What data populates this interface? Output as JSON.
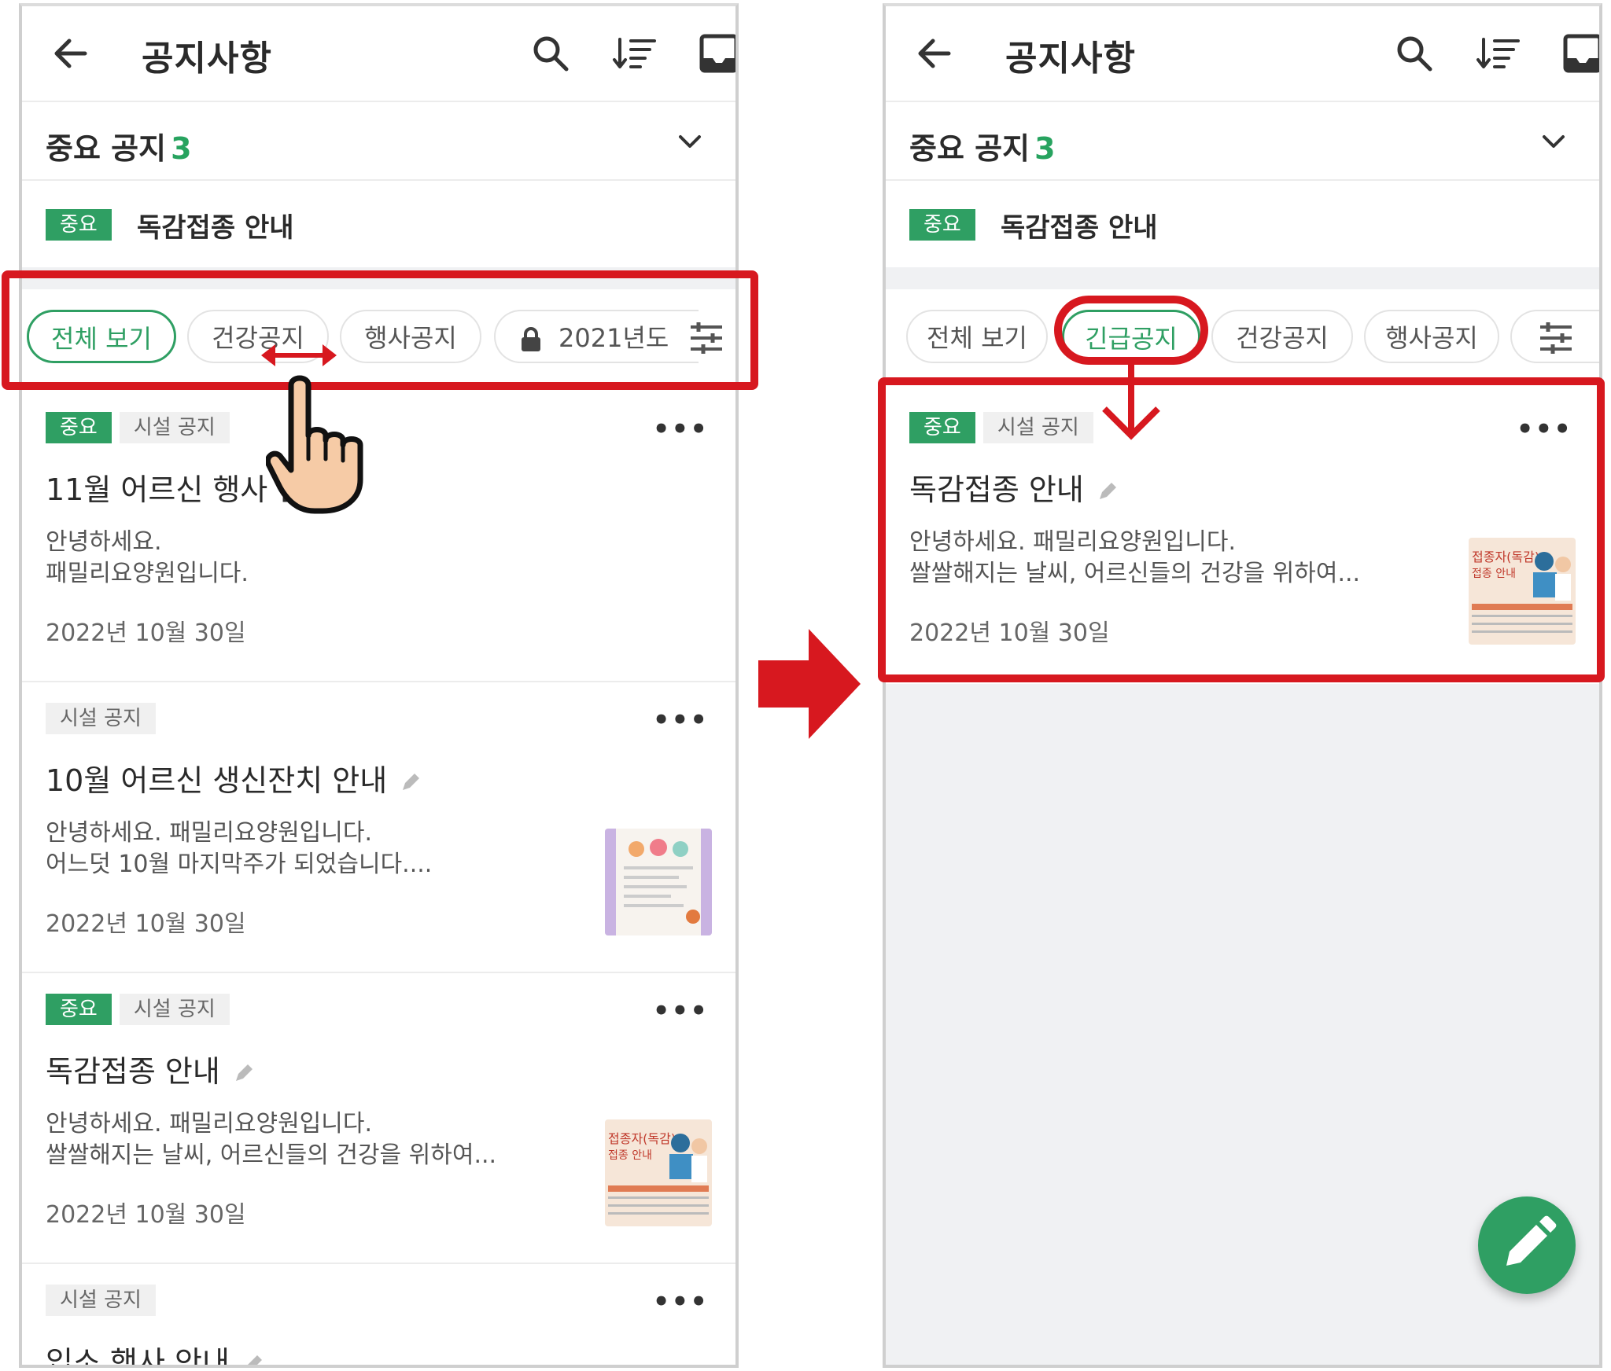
{
  "colors": {
    "accent_green": "#2f9f63",
    "highlight_red": "#d7181f",
    "badge_gray_bg": "#f0f0f0",
    "fill_gray": "#f0f1f3"
  },
  "left": {
    "appbar": {
      "title": "공지사항",
      "icons": [
        "back-arrow-icon",
        "search-icon",
        "sort-icon",
        "inbox-icon"
      ]
    },
    "important": {
      "label": "중요 공지",
      "count": "3",
      "item": {
        "badge": "중요",
        "title": "독감접종 안내"
      }
    },
    "chips": [
      "전체 보기",
      "건강공지",
      "행사공지",
      "2021년도"
    ],
    "posts": [
      {
        "badges": [
          "중요",
          "시설 공지"
        ],
        "title": "11월 어르신 행사 안내",
        "body1": "안녕하세요.",
        "body2": "패밀리요양원입니다.",
        "date": "2022년 10월 30일",
        "more": "•••"
      },
      {
        "badges": [
          "시설 공지"
        ],
        "title": "10월 어르신 생신잔치 안내",
        "body1": "안녕하세요. 패밀리요양원입니다.",
        "body2": "어느덧 10월 마지막주가 되었습니다....",
        "date": "2022년 10월 30일",
        "more": "•••"
      },
      {
        "badges": [
          "중요",
          "시설 공지"
        ],
        "title": "독감접종 안내",
        "body1": "안녕하세요. 패밀리요양원입니다.",
        "body2": "쌀쌀해지는 날씨, 어르신들의 건강을 위하여...",
        "date": "2022년 10월 30일",
        "more": "•••"
      },
      {
        "badges": [
          "시설 공지"
        ],
        "title": "입소 행사 안내",
        "more": "•••"
      }
    ]
  },
  "right": {
    "appbar": {
      "title": "공지사항"
    },
    "important": {
      "label": "중요 공지",
      "count": "3",
      "item": {
        "badge": "중요",
        "title": "독감접종 안내"
      }
    },
    "chips": [
      "전체 보기",
      "긴급공지",
      "건강공지",
      "행사공지"
    ],
    "post": {
      "badges": [
        "중요",
        "시설 공지"
      ],
      "title": "독감접종 안내",
      "body1": "안녕하세요. 패밀리요양원입니다.",
      "body2": "쌀쌀해지는 날씨, 어르신들의 건강을 위하여...",
      "date": "2022년 10월 30일",
      "more": "•••"
    },
    "fab_icon": "pencil-icon"
  },
  "thumb_texts": {
    "flu_title": "접종자(독감)",
    "flu_sub": "접종 안내"
  }
}
